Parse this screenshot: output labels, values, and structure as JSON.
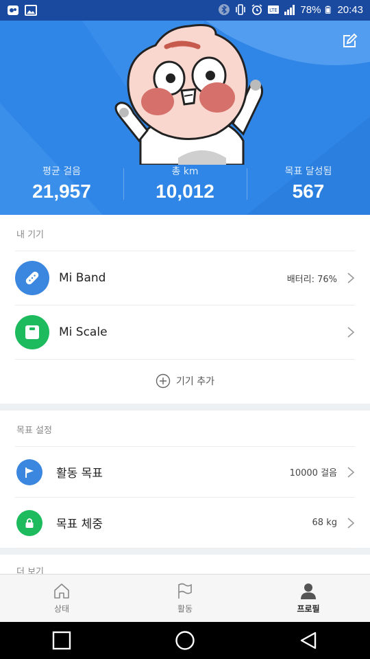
{
  "status_bar": {
    "battery": "78%",
    "time": "20:43"
  },
  "header": {
    "stats": [
      {
        "label": "평균 걸음",
        "value": "21,957"
      },
      {
        "label": "총 km",
        "value": "10,012"
      },
      {
        "label": "목표 달성됨",
        "value": "567"
      }
    ]
  },
  "devices": {
    "title": "내 기기",
    "items": [
      {
        "name": "Mi Band",
        "value": "배터리: 76%",
        "color": "#3b86de",
        "icon": "band-icon"
      },
      {
        "name": "Mi Scale",
        "value": "",
        "color": "#1dba5e",
        "icon": "scale-icon"
      }
    ],
    "add_label": "기기 추가"
  },
  "goals": {
    "title": "목표 설정",
    "items": [
      {
        "name": "활동 목표",
        "value": "10000 걸음",
        "color": "#3b86de",
        "icon": "flag-icon"
      },
      {
        "name": "목표 체중",
        "value": "68 kg",
        "color": "#1dba5e",
        "icon": "lock-icon"
      }
    ]
  },
  "next_section_peek": "더 보기",
  "tabs": [
    {
      "label": "상태",
      "icon": "home-icon",
      "active": false
    },
    {
      "label": "활동",
      "icon": "flag-outline-icon",
      "active": false
    },
    {
      "label": "프로필",
      "icon": "person-icon",
      "active": true
    }
  ],
  "colors": {
    "header_blue": "#2f86e6",
    "status_bar": "#1a4aa0",
    "accent_blue": "#3b86de",
    "accent_green": "#1dba5e"
  }
}
